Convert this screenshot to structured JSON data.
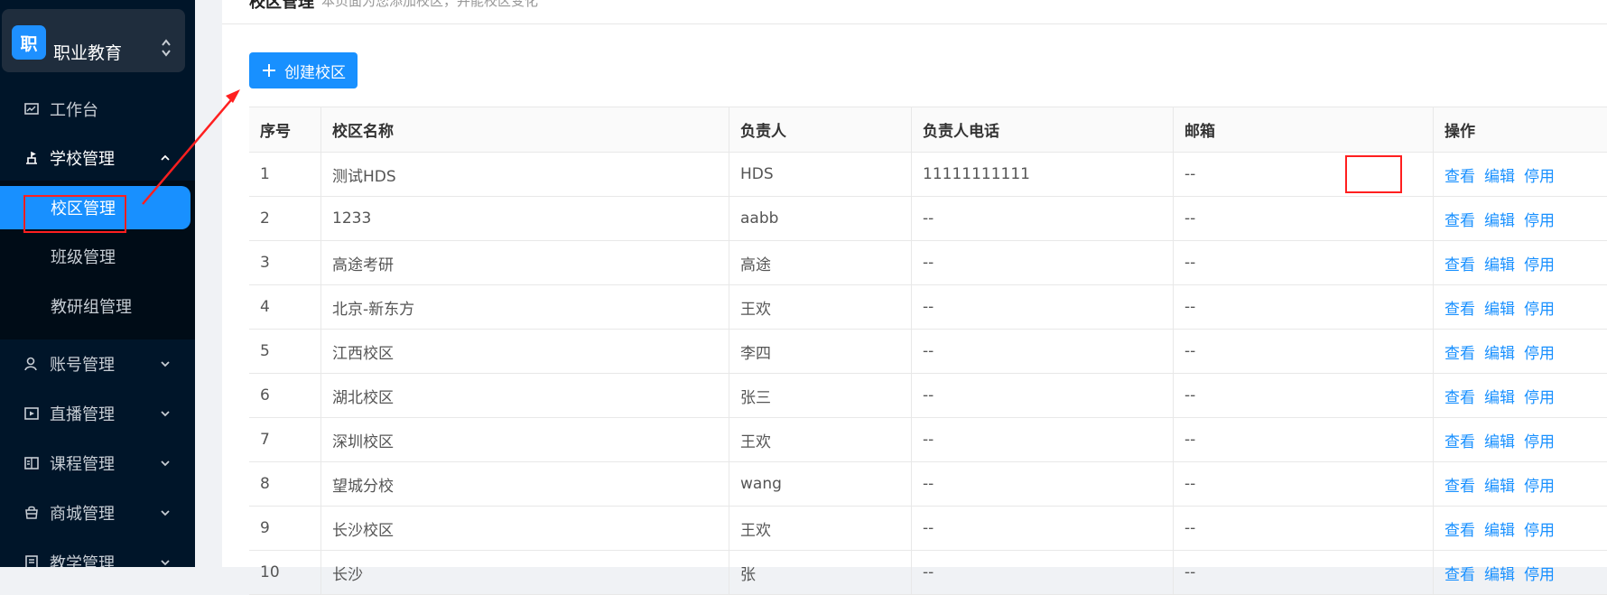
{
  "sidebar": {
    "brand": {
      "logo_char": "职",
      "name": "职业教育"
    },
    "items": [
      {
        "label": "工作台",
        "icon": "dashboard-icon"
      },
      {
        "label": "学校管理",
        "icon": "school-icon",
        "expanded": true
      },
      {
        "label": "账号管理",
        "icon": "account-icon"
      },
      {
        "label": "直播管理",
        "icon": "live-icon"
      },
      {
        "label": "课程管理",
        "icon": "course-icon"
      },
      {
        "label": "商城管理",
        "icon": "shop-icon"
      },
      {
        "label": "教学管理",
        "icon": "teaching-icon"
      }
    ],
    "sub_items": [
      "校区管理",
      "班级管理",
      "教研组管理"
    ],
    "active_sub": "校区管理",
    "accent": "#1890ff"
  },
  "page": {
    "title": "校区管理",
    "desc": "本页面为您添加校区，并能校区变化",
    "create_label": "创建校区"
  },
  "table": {
    "headers": [
      "序号",
      "校区名称",
      "负责人",
      "负责人电话",
      "邮箱",
      "操作"
    ],
    "rows": [
      [
        "1",
        "测试HDS",
        "HDS",
        "11111111111",
        "--"
      ],
      [
        "2",
        "1233",
        "aabb",
        "--",
        "--"
      ],
      [
        "3",
        "高途考研",
        "高途",
        "--",
        "--"
      ],
      [
        "4",
        "北京-新东方",
        "王欢",
        "--",
        "--"
      ],
      [
        "5",
        "江西校区",
        "李四",
        "--",
        "--"
      ],
      [
        "6",
        "湖北校区",
        "张三",
        "--",
        "--"
      ],
      [
        "7",
        "深圳校区",
        "王欢",
        "--",
        "--"
      ],
      [
        "8",
        "望城分校",
        "wang",
        "--",
        "--"
      ],
      [
        "9",
        "长沙校区",
        "王欢",
        "--",
        "--"
      ],
      [
        "10",
        "长沙",
        "张",
        "--",
        "--"
      ]
    ],
    "actions": [
      "查看",
      "编辑",
      "停用"
    ]
  }
}
